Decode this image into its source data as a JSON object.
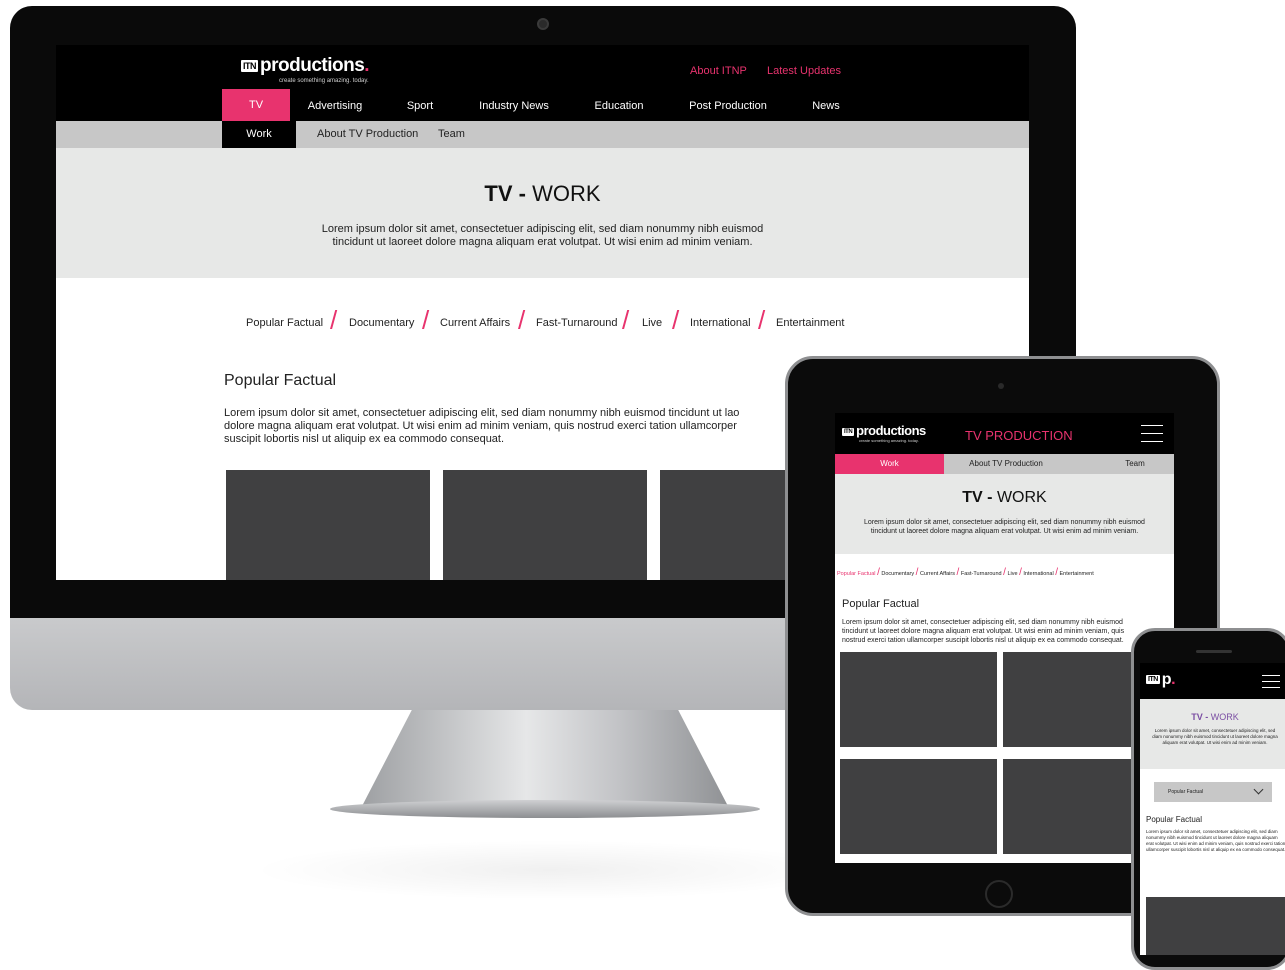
{
  "desktop": {
    "logo": {
      "badge": "ITN",
      "name": "productions",
      "tagline": "create something amazing. today."
    },
    "top_links": [
      "About ITNP",
      "Latest Updates"
    ],
    "nav": [
      "TV",
      "Advertising",
      "Sport",
      "Industry News",
      "Education",
      "Post Production",
      "News"
    ],
    "subnav": [
      "Work",
      "About TV Production",
      "Team"
    ],
    "hero": {
      "title_bold": "TV -",
      "title_rest": "WORK",
      "text_line1": "Lorem ipsum dolor sit amet, consectetuer adipiscing elit, sed diam nonummy nibh euismod",
      "text_line2": "tincidunt ut laoreet dolore magna aliquam erat volutpat. Ut wisi enim ad minim veniam."
    },
    "filters": [
      "Popular Factual",
      "Documentary",
      "Current Affairs",
      "Fast-Turnaround",
      "Live",
      "International",
      "Entertainment"
    ],
    "section": {
      "heading": "Popular Factual",
      "line1": "Lorem ipsum dolor sit amet, consectetuer adipiscing elit, sed diam nonummy nibh euismod tincidunt ut lao",
      "line2": "dolore magna aliquam erat volutpat. Ut wisi enim ad minim veniam, quis nostrud exerci tation ullamcorper",
      "line3": "suscipit lobortis nisl ut aliquip ex ea commodo consequat."
    }
  },
  "tablet": {
    "logo": {
      "badge": "ITN",
      "name": "productions",
      "tagline": "create something amazing. today."
    },
    "header_title": "TV PRODUCTION",
    "subnav": [
      "Work",
      "About TV Production",
      "Team"
    ],
    "hero": {
      "title_bold": "TV -",
      "title_rest": "WORK",
      "text_line1": "Lorem ipsum dolor sit amet, consectetuer adipiscing elit, sed diam nonummy nibh euismod",
      "text_line2": "tincidunt ut laoreet dolore magna aliquam erat volutpat. Ut wisi enim ad minim veniam."
    },
    "filters": [
      "Popular Factual",
      "Documentary",
      "Current Affairs",
      "Fast-Turnaround",
      "Live",
      "International",
      "Entertainment"
    ],
    "section": {
      "heading": "Popular Factual",
      "line1": "Lorem ipsum dolor sit amet, consectetuer adipiscing elit, sed diam nonummy nibh euismod",
      "line2": "tincidunt ut laoreet dolore magna aliquam erat volutpat. Ut wisi enim ad minim veniam, quis",
      "line3": "nostrud exerci tation ullamcorper suscipit lobortis nisl ut aliquip ex ea commodo consequat."
    }
  },
  "phone": {
    "logo": {
      "badge": "ITN",
      "name": "p"
    },
    "hero": {
      "title_bold": "TV -",
      "title_rest": "WORK",
      "text": "Lorem ipsum dolor sit amet, consectetuer adipiscing elit, sed diam nonummy nibh euismod tincidunt ut laoreet dolore magna aliquam erat volutpat. Ut wisi enim ad minim veniam."
    },
    "select_value": "Popular Factual",
    "section": {
      "heading": "Popular Factual",
      "text": "Lorem ipsum dolor sit amet, consectetuer adipiscing elit, sed diam nonummy nibh euismod tincidunt ut laoreet dolore magna aliquam erat volutpat. Ut wisi enim ad minim veniam, quis nostrud exerci tation ullamcorper suscipit lobortis nisl ut aliquip ex ea commodo consequat."
    }
  },
  "colors": {
    "accent": "#e8336e",
    "header": "#000000",
    "hero_bg": "#e7e8e7",
    "subnav_bg": "#c7c7c7",
    "tile": "#404041",
    "phone_title": "#7b4ea3"
  }
}
